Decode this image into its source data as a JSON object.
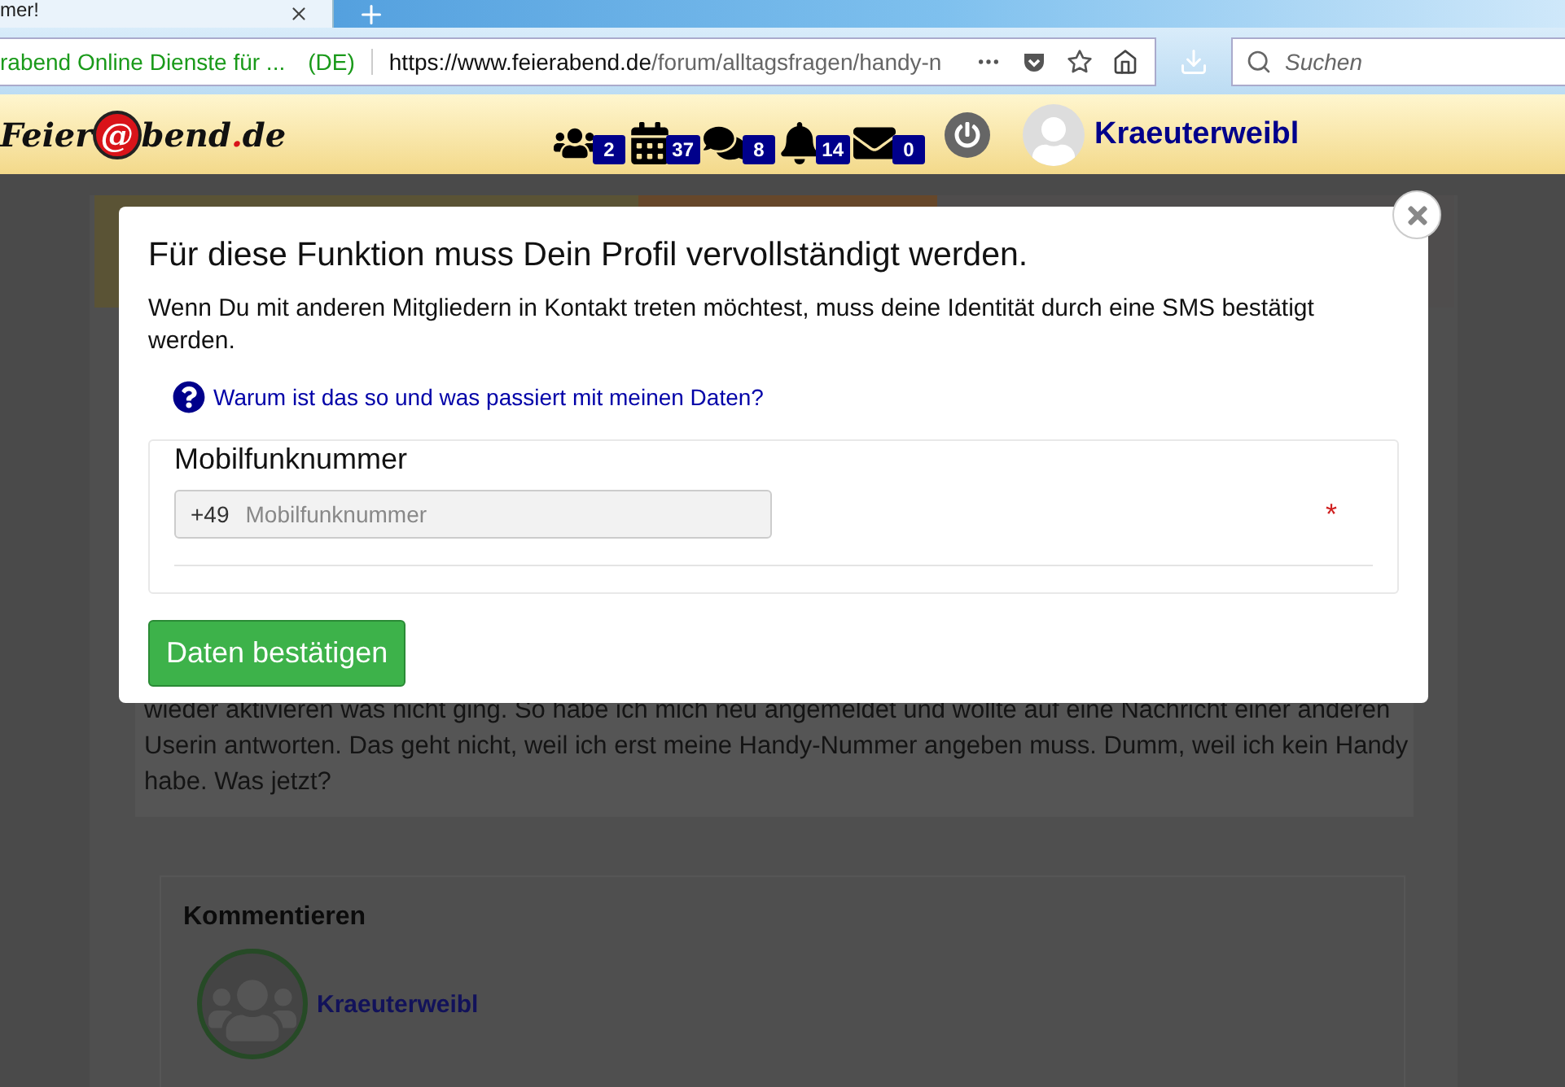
{
  "browser": {
    "tab": {
      "title": "mer!"
    },
    "identity": {
      "name": "rabend Online Dienste für ...",
      "country": "(DE)"
    },
    "url": {
      "host": "https://www.feierabend.de",
      "path": "/forum/alltagsfragen/handy-n"
    },
    "search": {
      "placeholder": "Suchen"
    }
  },
  "header": {
    "logo": {
      "prefix": "Feier",
      "mark": "@",
      "suffix": "bend",
      "dot": ".",
      "tld": "de"
    },
    "nav": [
      {
        "kind": "users",
        "count": "2"
      },
      {
        "kind": "calendar",
        "count": "37"
      },
      {
        "kind": "chat",
        "count": "8"
      },
      {
        "kind": "bell",
        "count": "14"
      },
      {
        "kind": "mail",
        "count": "0"
      }
    ],
    "user": "Kraeuterweibl"
  },
  "post": {
    "lines": [
      "wieder aktivieren was nicht ging. So habe ich mich neu angemeldet und wollte auf eine Nachricht einer anderen",
      "Userin antworten. Das geht nicht, weil ich erst meine Handy-Nummer angeben muss. Dumm, weil ich kein Handy",
      "habe. Was jetzt?"
    ]
  },
  "comment": {
    "heading": "Kommentieren",
    "user": "Kraeuterweibl"
  },
  "modal": {
    "title": "Für diese Funktion muss Dein Profil vervollständigt werden.",
    "text": "Wenn Du mit anderen Mitgliedern in Kontakt treten möchtest, muss deine Identität durch eine SMS bestätigt werden.",
    "help_link": "Warum ist das so und was passiert mit meinen Daten?",
    "field": {
      "label": "Mobilfunknummer",
      "prefix": "+49",
      "placeholder": "Mobilfunknummer",
      "required": true,
      "required_mark": "*"
    },
    "button": "Daten bestätigen"
  }
}
